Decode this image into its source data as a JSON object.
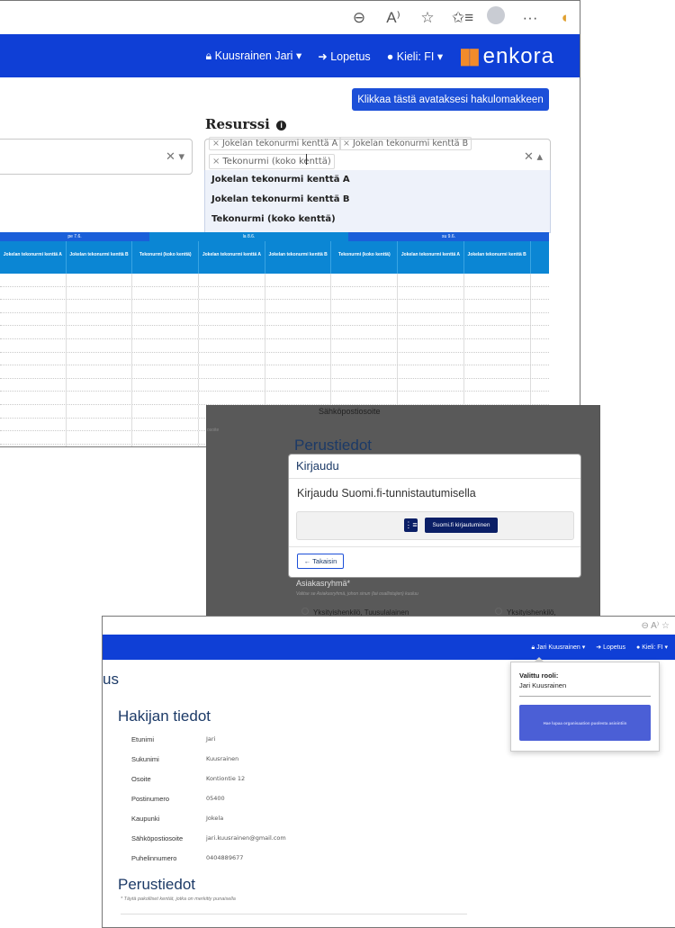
{
  "panel1": {
    "browser": {
      "icons": [
        "zoom-icon",
        "read-aloud-icon",
        "favorite-star-icon",
        "favorites-list-icon",
        "profile-avatar-icon",
        "more-icon",
        "extension-icon"
      ],
      "zoom_glyph": "⊖",
      "read_glyph": "A⁾",
      "star_glyph": "☆",
      "favs_glyph": "✩≡",
      "more_glyph": "···"
    },
    "nav": {
      "user": "Kuusrainen Jari",
      "user_caret": "▾",
      "logout": "Lopetus",
      "language": "Kieli: FI",
      "language_caret": "▾",
      "logo": "enkora"
    },
    "form_button": "Klikkaa tästä avataksesi hakulomakkeen",
    "resource_label": "Resurssi",
    "resource_info": "i",
    "select_left_controls": "✕ ▾",
    "selected_tags": [
      "Jokelan tekonurmi kenttä A",
      "Jokelan tekonurmi kenttä B",
      "Tekonurmi (koko kenttä)"
    ],
    "tag_remove": "×",
    "select_right_controls": "✕ ▴",
    "dropdown_options": [
      "Jokelan tekonurmi kenttä A",
      "Jokelan tekonurmi kenttä B",
      "Tekonurmi (koko kenttä)"
    ],
    "table": {
      "day_headers": [
        "pe 7.6.",
        "la 8.6.",
        "su 9.6."
      ],
      "columns": [
        "Jokelan tekonurmi kenttä A",
        "Jokelan tekonurmi kenttä B",
        "Tekonurmi (koko kenttä)",
        "Jokelan tekonurmi kenttä A",
        "Jokelan tekonurmi kenttä B",
        "Tekonurmi (koko kenttä)",
        "Jokelan tekonurmi kenttä A",
        "Jokelan tekonurmi kenttä B"
      ],
      "row_count": 15
    }
  },
  "panel2": {
    "email_label": "Sähköpostiosoite",
    "faint_text": "osoite",
    "section_title": "Perustiedot",
    "modal": {
      "title": "Kirjaudu",
      "subtitle": "Kirjaudu Suomi.fi-tunnistautumisella",
      "suomifi_button": "Suomi.fi kirjautuminen",
      "back_button": "Takaisin"
    },
    "customer_group_label": "Asiakasryhmä*",
    "customer_group_hint": "Valitse se Asiakasryhmä, johon sinun (tai osallistujien) kuuluu",
    "radio_options": [
      "Yksityishenkilö, Tuusulalainen",
      "Yksityishenkilö, ulkopaikkakuntalai"
    ]
  },
  "panel3": {
    "browser_icons": "⊖ A⁾ ☆",
    "nav": {
      "user": "Jari Kuusrainen",
      "user_caret": "▾",
      "logout": "Lopetus",
      "language": "Kieli: FI",
      "language_caret": "▾"
    },
    "page_heading_fragment": "us",
    "section_title": "Hakijan tiedot",
    "fields": [
      {
        "label": "Etunimi",
        "value": "Jari"
      },
      {
        "label": "Sukunimi",
        "value": "Kuusrainen"
      },
      {
        "label": "Osoite",
        "value": "Kontiontie 12"
      },
      {
        "label": "Postinumero",
        "value": "05400"
      },
      {
        "label": "Kaupunki",
        "value": "Jokela"
      },
      {
        "label": "Sähköpostiosoite",
        "value": "jari.kuusrainen@gmail.com"
      },
      {
        "label": "Puhelinnumero",
        "value": "0404889677"
      }
    ],
    "basic_info_title": "Perustiedot",
    "required_note": "* Täytä pakolliset kentät, jotka on merkitty punaisella",
    "role_popup": {
      "title": "Valittu rooli:",
      "role": "Jari Kuusrainen",
      "button": "Hae lupaa organisaation puolesta asiointiin"
    }
  }
}
